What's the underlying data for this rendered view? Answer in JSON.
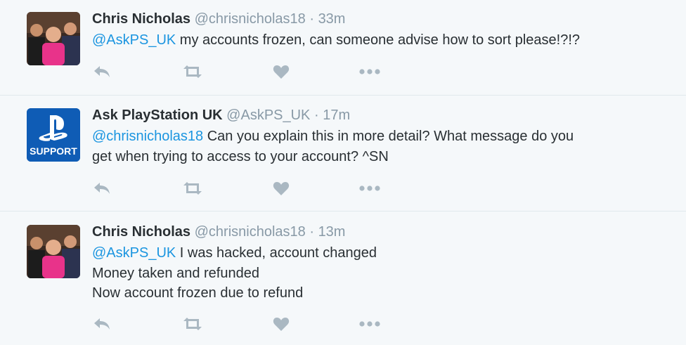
{
  "tweets": [
    {
      "fullname": "Chris Nicholas",
      "handle": "@chrisnicholas18",
      "separator": "·",
      "time": "33m",
      "mention": "@AskPS_UK",
      "lines": [
        "my accounts frozen, can someone advise how to sort please!?!?"
      ],
      "avatar_icon": "user-photo-avatar"
    },
    {
      "fullname": "Ask PlayStation UK",
      "handle": "@AskPS_UK",
      "separator": "·",
      "time": "17m",
      "mention": "@chrisnicholas18",
      "lines": [
        "Can you explain this in more detail? What message do you",
        "get when trying to access to your account? ^SN"
      ],
      "avatar_label": "SUPPORT",
      "avatar_icon": "playstation-logo"
    },
    {
      "fullname": "Chris Nicholas",
      "handle": "@chrisnicholas18",
      "separator": "·",
      "time": "13m",
      "mention": "@AskPS_UK",
      "lines": [
        "I was hacked, account changed",
        "Money taken and refunded",
        "Now account frozen due to refund"
      ],
      "avatar_icon": "user-photo-avatar"
    }
  ],
  "action_icons": [
    "reply-icon",
    "retweet-icon",
    "like-icon",
    "more-icon"
  ],
  "colors": {
    "background": "#f5f8fa",
    "mention": "#1b95e0",
    "action_icon": "#aab8c2",
    "ps_blue": "#0f5cb5"
  }
}
